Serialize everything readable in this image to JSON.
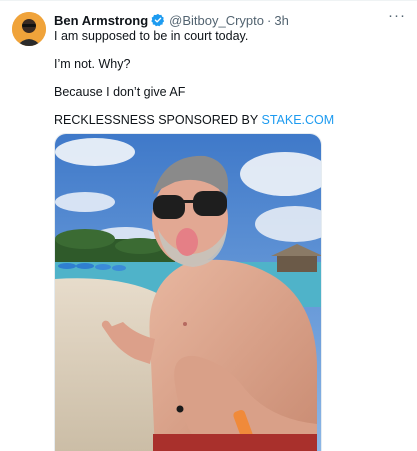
{
  "tweet": {
    "author_name": "Ben Armstrong",
    "handle": "@Bitboy_Crypto",
    "separator": "·",
    "time": "3h",
    "more_label": "···",
    "lines": {
      "line1": "I am supposed to be in court today.",
      "line2": "I’m not. Why?",
      "line3": "Because I don’t give AF",
      "line4_prefix": "RECKLESSNESS SPONSORED BY ",
      "line4_link": "STAKE.COM"
    },
    "badge_icon": "verified-badge-icon",
    "link_color": "#1d9bf0",
    "badge_color": "#1d9bf0"
  }
}
